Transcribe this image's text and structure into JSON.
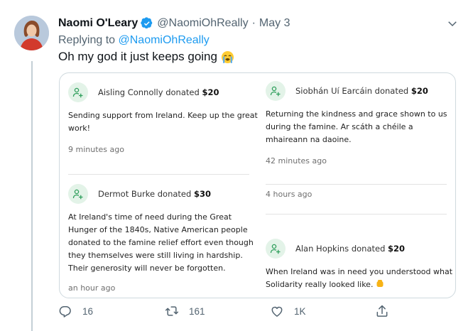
{
  "tweet": {
    "author_name": "Naomi O'Leary",
    "handle": "@NaomiOhReally",
    "separator": "·",
    "date": "May 3",
    "replying_prefix": "Replying to",
    "replying_handle": "@NaomiOhReally",
    "text": "Oh my god it just keeps going",
    "emoji_icon": "loudly-crying-face-icon"
  },
  "donations": [
    {
      "donor": "Aisling Connolly donated",
      "amount": "$20",
      "message": "Sending support from Ireland. Keep up the great work!",
      "time": "9 minutes ago"
    },
    {
      "donor": "Siobhán Uí Earcáin donated",
      "amount": "$20",
      "message": "Returning the kindness and grace shown to us during the famine. Ar scáth a chéile a mhaireann na daoine.",
      "time": "42 minutes ago"
    },
    {
      "donor": "Dermot Burke donated",
      "amount": "$30",
      "message": "At Ireland's time of need during the Great Hunger of the 1840s, Native American people donated to the famine relief effort even though they themselves were still living in hardship. Their generosity will never be forgotten.",
      "time": "an hour ago"
    },
    {
      "time": "4 hours ago"
    },
    {
      "donor": "Alan Hopkins donated",
      "amount": "$20",
      "message": "When Ireland was in need you understood what Solidarity really looked like.",
      "emoji_icon": "raised-fist-icon"
    }
  ],
  "actions": {
    "reply_count": "16",
    "retweet_count": "161",
    "like_count": "1K"
  },
  "colors": {
    "link": "#1d9bf0",
    "muted": "#536471",
    "donor_icon_bg": "#e3f3e8",
    "donor_icon": "#2e9e5b"
  }
}
